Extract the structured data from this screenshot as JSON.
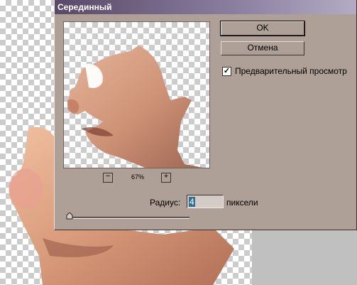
{
  "dialog": {
    "title": "Серединный",
    "ok_label": "OK",
    "cancel_label": "Отмена",
    "preview_label": "Предварительный просмотр",
    "preview_checked": true,
    "zoom_minus_label": "−",
    "zoom_plus_label": "+",
    "zoom_value": "67%",
    "radius_label": "Радиус:",
    "radius_value": "4",
    "radius_units": "пиксели"
  },
  "colors": {
    "dialog_bg": "#ae9f97",
    "title_start": "#5a4868",
    "title_end": "#b3acc4",
    "skin": "#d9a080"
  },
  "icons": {
    "checkbox": "check-mark",
    "slider": "triangle-thumb"
  }
}
